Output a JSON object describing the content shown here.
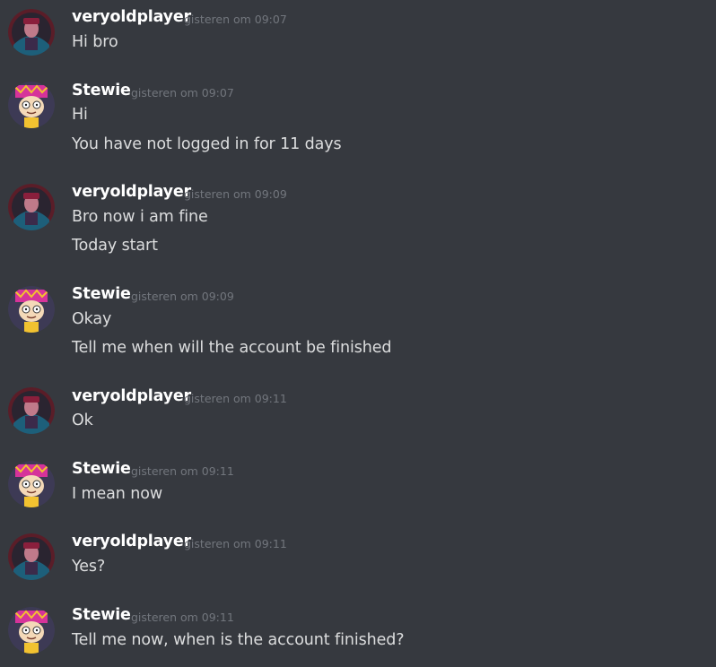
{
  "messages": [
    {
      "author": "veryoldplayer",
      "avatar": "player-avatar-icon",
      "timestamp": "gisteren om 09:07",
      "lines": [
        "Hi bro"
      ]
    },
    {
      "author": "Stewie",
      "avatar": "stewie-avatar-icon",
      "timestamp": "gisteren om 09:07",
      "lines": [
        "Hi",
        "You have not logged in for 11 days"
      ]
    },
    {
      "author": "veryoldplayer",
      "avatar": "player-avatar-icon",
      "timestamp": "gisteren om 09:09",
      "lines": [
        "Bro now i am fine",
        "Today start"
      ]
    },
    {
      "author": "Stewie",
      "avatar": "stewie-avatar-icon",
      "timestamp": "gisteren om 09:09",
      "lines": [
        "Okay",
        "Tell me when will the account be finished"
      ]
    },
    {
      "author": "veryoldplayer",
      "avatar": "player-avatar-icon",
      "timestamp": "gisteren om 09:11",
      "lines": [
        "Ok"
      ]
    },
    {
      "author": "Stewie",
      "avatar": "stewie-avatar-icon",
      "timestamp": "gisteren om 09:11",
      "lines": [
        "I mean now"
      ]
    },
    {
      "author": "veryoldplayer",
      "avatar": "player-avatar-icon",
      "timestamp": "gisteren om 09:11",
      "lines": [
        "Yes?"
      ]
    },
    {
      "author": "Stewie",
      "avatar": "stewie-avatar-icon",
      "timestamp": "gisteren om 09:11",
      "lines": [
        "Tell me now, when is the account finished?"
      ]
    }
  ],
  "colors": {
    "background": "#36393f",
    "username": "#ffffff",
    "timestamp": "#72767d",
    "text": "#dcddde"
  }
}
